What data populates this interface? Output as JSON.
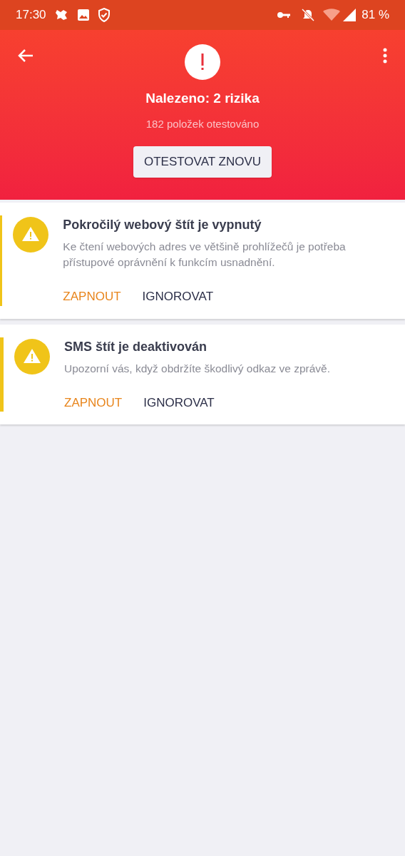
{
  "status_bar": {
    "time": "17:30",
    "battery": "81 %"
  },
  "header": {
    "title": "Nalezeno: 2 rizika",
    "subtitle": "182 položek otestováno",
    "button": "OTESTOVAT ZNOVU"
  },
  "issues": [
    {
      "title": "Pokročilý webový štít je vypnutý",
      "description": "Ke čtení webových adres ve většině prohlížečů je potřeba přístupové oprávnění k funkcím usnadnění.",
      "actions": [
        {
          "label": "ZAPNOUT",
          "kind": "primary"
        },
        {
          "label": "IGNOROVAT",
          "kind": "secondary"
        }
      ]
    },
    {
      "title": "SMS štít je deaktivován",
      "description": "Upozorní vás, když obdržíte škodlivý odkaz ve zprávě.",
      "actions": [
        {
          "label": "ZAPNOUT",
          "kind": "primary"
        },
        {
          "label": "IGNOROVAT",
          "kind": "secondary"
        }
      ]
    }
  ]
}
